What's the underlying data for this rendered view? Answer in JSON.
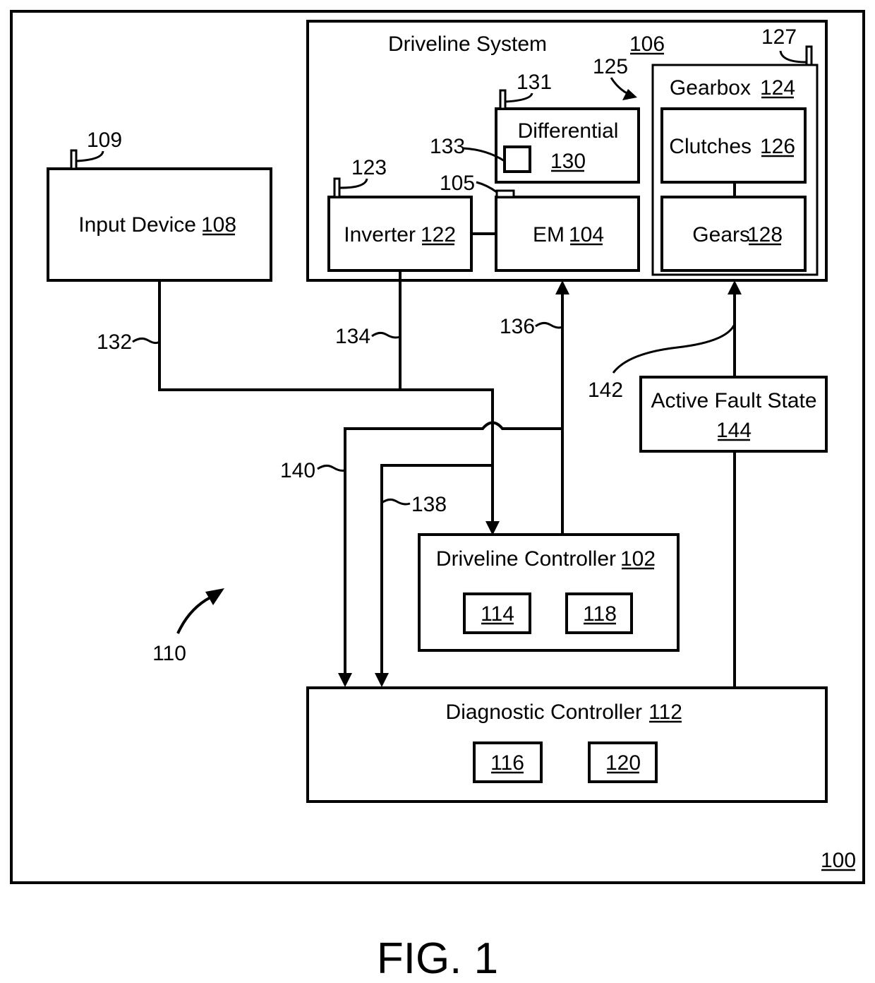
{
  "figure": {
    "caption": "FIG. 1",
    "system_ref": "100",
    "vehicle_ref": "110"
  },
  "blocks": {
    "driveline_system": {
      "name": "Driveline System",
      "ref": "106"
    },
    "gearbox": {
      "name": "Gearbox",
      "ref": "124"
    },
    "clutches": {
      "name": "Clutches",
      "ref": "126"
    },
    "gears": {
      "name": "Gears",
      "ref": "128"
    },
    "differential": {
      "name": "Differential",
      "ref": "130"
    },
    "inverter": {
      "name": "Inverter",
      "ref": "122"
    },
    "em": {
      "name": "EM",
      "ref": "104"
    },
    "input_device": {
      "name": "Input Device",
      "ref": "108"
    },
    "active_fault_state": {
      "name": "Active Fault State",
      "ref": "144"
    },
    "driveline_controller": {
      "name": "Driveline Controller",
      "ref": "102",
      "sub_refs": [
        "114",
        "118"
      ]
    },
    "diagnostic_controller": {
      "name": "Diagnostic Controller",
      "ref": "112",
      "sub_refs": [
        "116",
        "120"
      ]
    }
  },
  "callouts": {
    "sensor_input_device": "109",
    "sensor_inverter": "123",
    "sensor_em": "105",
    "sensor_differential": "131",
    "differential_component": "133",
    "sensor_gearbox": "127",
    "gearbox_arrow": "125",
    "signal_input": "132",
    "signal_inverter": "134",
    "signal_command": "136",
    "signal_to_diag_138": "138",
    "signal_to_diag_140": "140",
    "signal_fault": "142"
  }
}
